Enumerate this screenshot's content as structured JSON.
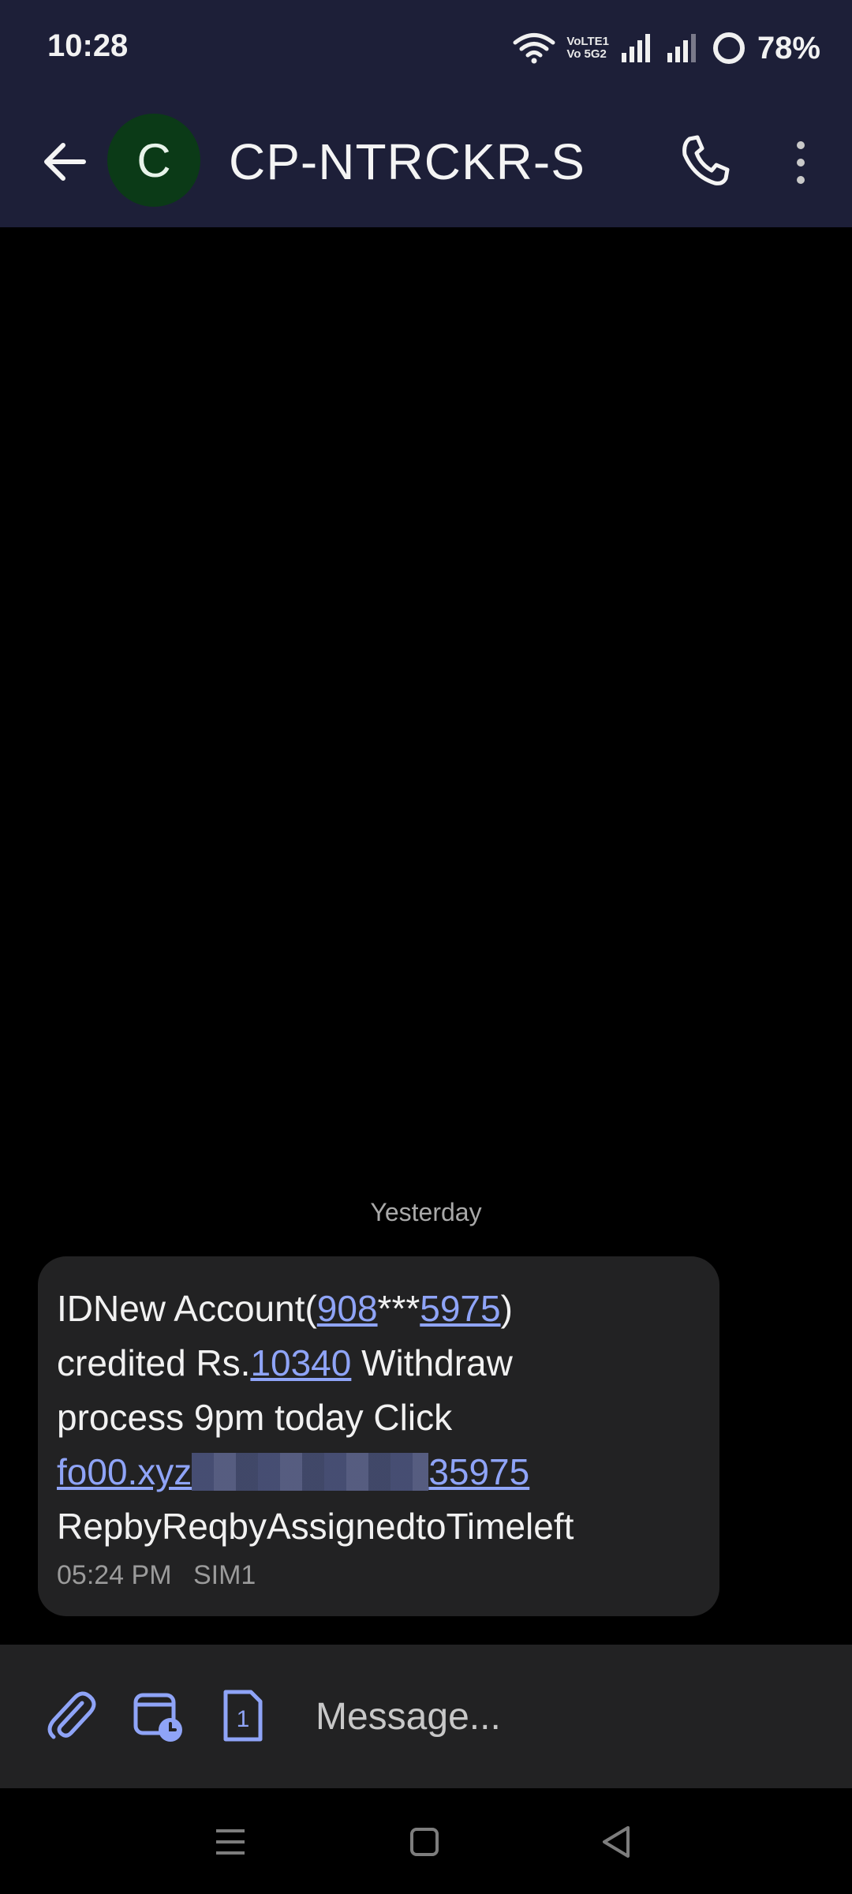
{
  "status_bar": {
    "time": "10:28",
    "volte_top": "VoLTE1",
    "volte_bottom": "Vo 5G2",
    "battery": "78%"
  },
  "header": {
    "avatar_letter": "C",
    "title": "CP-NTRCKR-S"
  },
  "conversation": {
    "date_separator": "Yesterday",
    "message": {
      "line1_a": "IDNew Account(",
      "line1_link1": "908",
      "line1_b": "***",
      "line1_link2": "5975",
      "line1_c": ")",
      "line2_a": "credited Rs.",
      "line2_link": "10340",
      "line2_b": " Withdraw",
      "line3": "process  9pm today Click",
      "line4_link_start": "fo00.xyz",
      "line4_link_end": "35975",
      "line5": "RepbyReqbyAssignedtoTimeleft",
      "time": "05:24 PM",
      "sim": "SIM1"
    }
  },
  "compose": {
    "placeholder": "Message..."
  },
  "icons": [
    "back-arrow-icon",
    "phone-icon",
    "more-vert-icon",
    "paperclip-icon",
    "schedule-icon",
    "sim-icon",
    "wifi-icon",
    "signal-icon",
    "battery-icon"
  ],
  "colors": {
    "header_bg": "#1d1f38",
    "avatar_bg": "#0b3a17",
    "link": "#8fa4f7",
    "bubble_bg": "#222223",
    "accent_icon": "#8fa4f7"
  }
}
